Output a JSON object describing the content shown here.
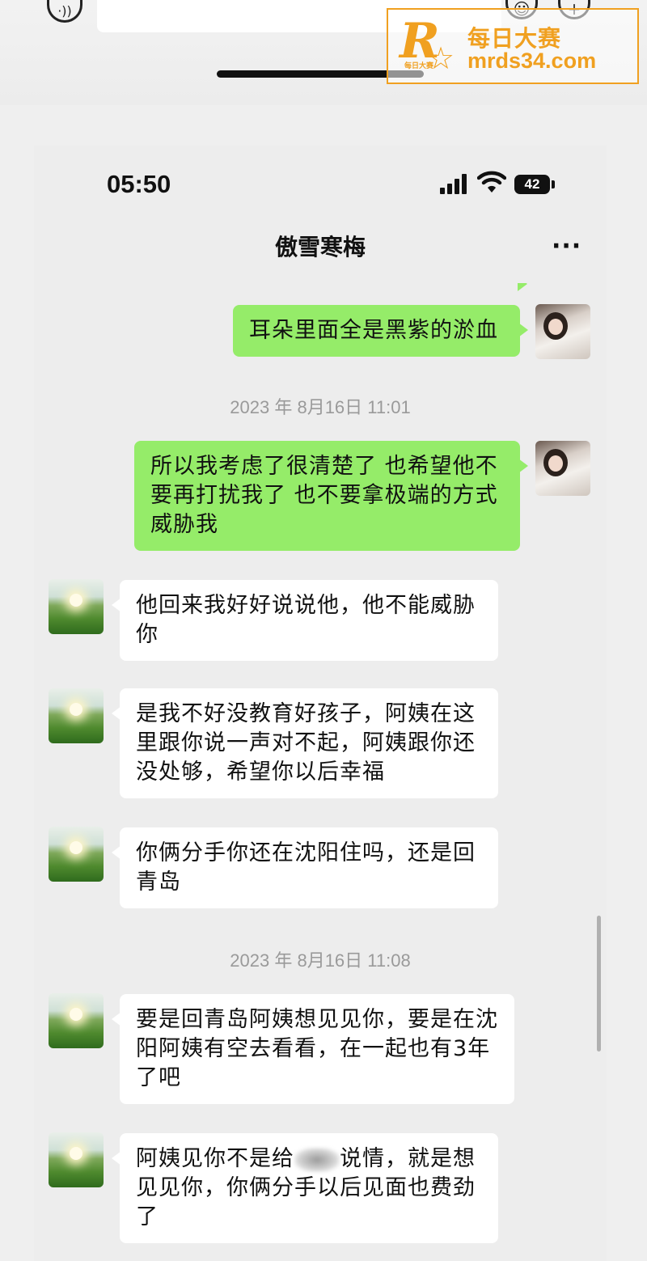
{
  "status_bar": {
    "time": "05:50",
    "battery": "42"
  },
  "chat": {
    "title": "傲雪寒梅"
  },
  "messages": [
    {
      "type": "sent",
      "text": "耳朵里面全是黑紫的淤血"
    },
    {
      "type": "time",
      "text": "2023 年 8月16日 11:01"
    },
    {
      "type": "sent",
      "text": "所以我考虑了很清楚了 也希望他不要再打扰我了 也不要拿极端的方式威胁我"
    },
    {
      "type": "recv",
      "text": "他回来我好好说说他，他不能威胁你"
    },
    {
      "type": "recv",
      "text": "是我不好没教育好孩子，阿姨在这里跟你说一声对不起，阿姨跟你还没处够，希望你以后幸福"
    },
    {
      "type": "recv",
      "text": "你俩分手你还在沈阳住吗，还是回青岛"
    },
    {
      "type": "time",
      "text": "2023 年 8月16日 11:08"
    },
    {
      "type": "recv",
      "text": "要是回青岛阿姨想见见你，要是在沈阳阿姨有空去看看，在一起也有3年了吧"
    },
    {
      "type": "recv",
      "text_before": "阿姨见你不是给",
      "text_after": "说情，就是想见见你，你俩分手以后见面也费劲了"
    }
  ],
  "watermark": {
    "brand": "每日大赛",
    "url": "mrds34.com",
    "letter": "R",
    "small": "每日大赛"
  },
  "icons": [
    "voice-icon",
    "emoji-icon",
    "plus-icon",
    "back-icon",
    "more-icon",
    "signal-icon",
    "wifi-icon",
    "battery-icon"
  ]
}
